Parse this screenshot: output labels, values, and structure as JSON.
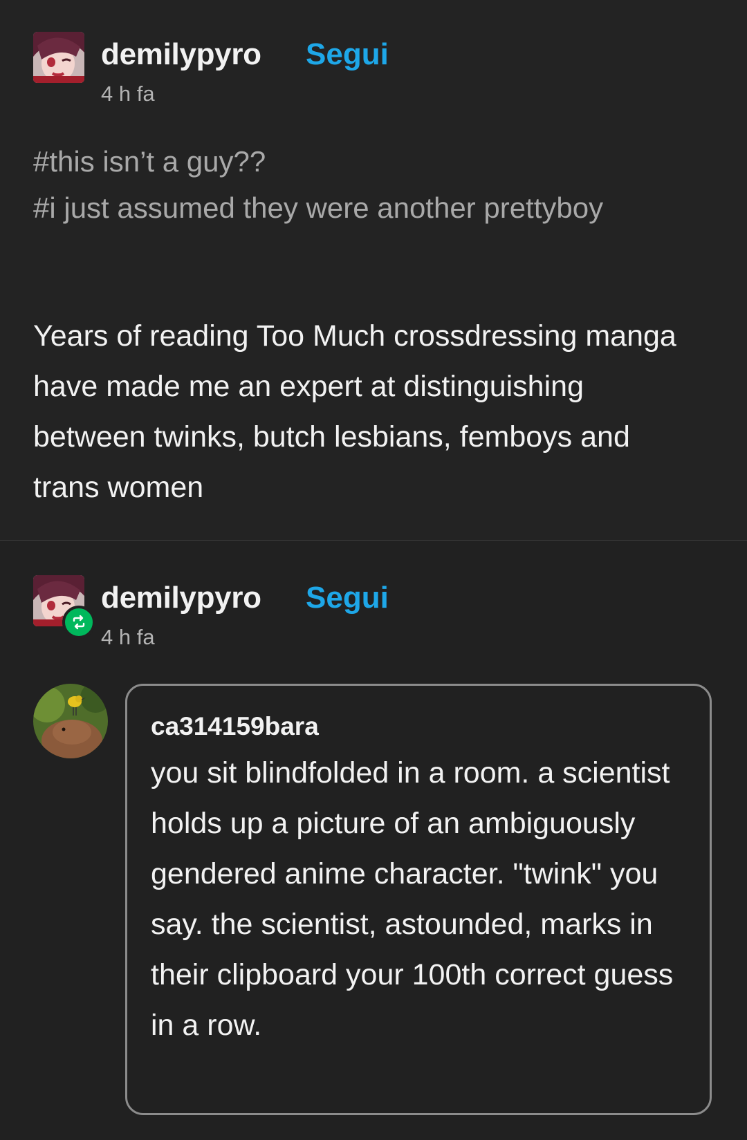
{
  "post_top": {
    "username": "demilypyro",
    "follow_label": "Segui",
    "time": "4 h fa",
    "tags": [
      "#this isn’t a guy??",
      "#i just assumed they were another prettyboy"
    ],
    "body": "Years of reading Too Much crossdressing manga have made me an expert at distinguishing between twinks, butch lesbians, femboys and trans women"
  },
  "post_reblog": {
    "username": "demilypyro",
    "follow_label": "Segui",
    "time": "4 h fa",
    "reblog_icon": "reblog-icon",
    "quote": {
      "username": "ca314159bara",
      "text": "you sit blindfolded in a room. a scientist holds up a picture of an ambiguously gendered anime character. \"twink\" you say. the scientist, astounded, marks in their clipboard your 100th correct guess in a row."
    }
  },
  "colors": {
    "background": "#232323",
    "follow_accent": "#1ea7e8",
    "reblog_green": "#00b85c",
    "tag_gray": "#a9a9a9"
  }
}
